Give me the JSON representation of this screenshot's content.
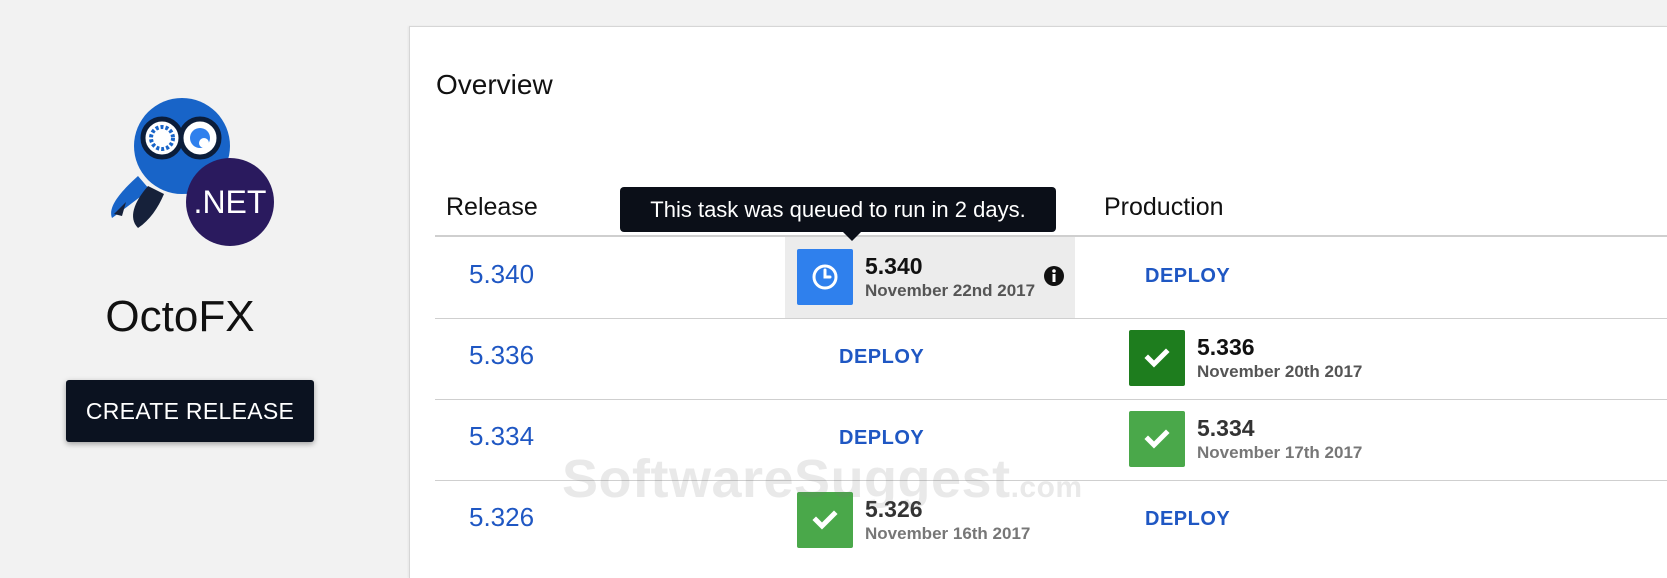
{
  "sidebar": {
    "project_name": "OctoFX",
    "logo_text": ".NET",
    "create_release_label": "CREATE RELEASE"
  },
  "overview": {
    "title": "Overview",
    "columns": [
      "Release",
      "Production"
    ],
    "tooltip": "This task was queued to run in 2 days.",
    "rows": [
      {
        "release": "5.340",
        "stage_col": {
          "type": "status",
          "status": "queued",
          "icon": "clock-icon",
          "version": "5.340",
          "date": "November 22nd 2017",
          "info_icon": true
        },
        "production": {
          "type": "deploy",
          "label": "DEPLOY"
        }
      },
      {
        "release": "5.336",
        "stage_col": {
          "type": "deploy",
          "label": "DEPLOY"
        },
        "production": {
          "type": "status",
          "status": "success-current",
          "icon": "checkmark-icon",
          "version": "5.336",
          "date": "November 20th 2017"
        }
      },
      {
        "release": "5.334",
        "stage_col": {
          "type": "deploy",
          "label": "DEPLOY"
        },
        "production": {
          "type": "status",
          "status": "success-previous",
          "icon": "checkmark-icon",
          "version": "5.334",
          "date": "November 17th 2017"
        }
      },
      {
        "release": "5.326",
        "stage_col": {
          "type": "status",
          "status": "success-previous",
          "icon": "checkmark-icon",
          "version": "5.326",
          "date": "November 16th 2017"
        },
        "production": {
          "type": "deploy",
          "label": "DEPLOY"
        }
      }
    ]
  },
  "watermark": {
    "main": "SoftwareSuggest",
    "suffix": ".com"
  },
  "colors": {
    "link_blue": "#1f57c3",
    "queued_blue": "#2f80ed",
    "success_dark": "#1e7d1e",
    "success_light": "#4aa84a",
    "button_dark": "#0b1220"
  }
}
